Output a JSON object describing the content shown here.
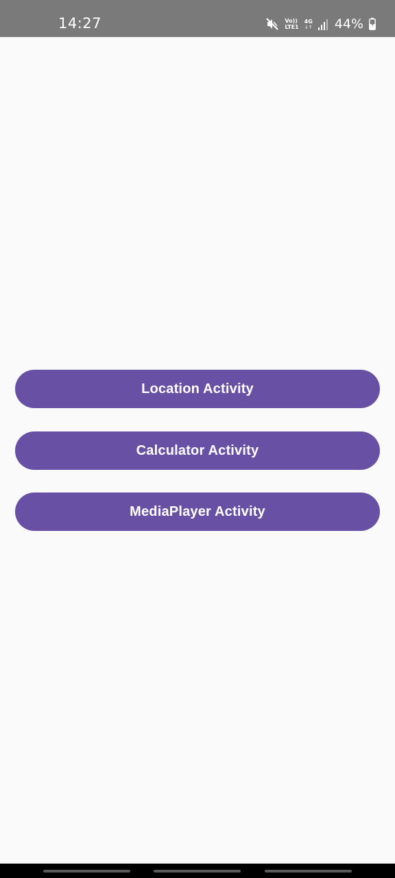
{
  "status_bar": {
    "time": "14:27",
    "volte_top": "Vo))",
    "volte_bottom": "LTE1",
    "network_type": "4G",
    "network_arrows": "↓↑",
    "battery_percent": "44%",
    "icons": [
      "mute-icon",
      "volte-icon",
      "network-4g-icon",
      "signal-icon",
      "battery-charging-icon"
    ]
  },
  "main": {
    "buttons": [
      {
        "label": "Location Activity"
      },
      {
        "label": "Calculator Activity"
      },
      {
        "label": "MediaPlayer Activity"
      }
    ]
  },
  "colors": {
    "status_bar": "#7a7a7a",
    "background": "#fafafa",
    "button": "#6851a5",
    "button_text": "#ffffff",
    "nav_bar": "#000000"
  }
}
